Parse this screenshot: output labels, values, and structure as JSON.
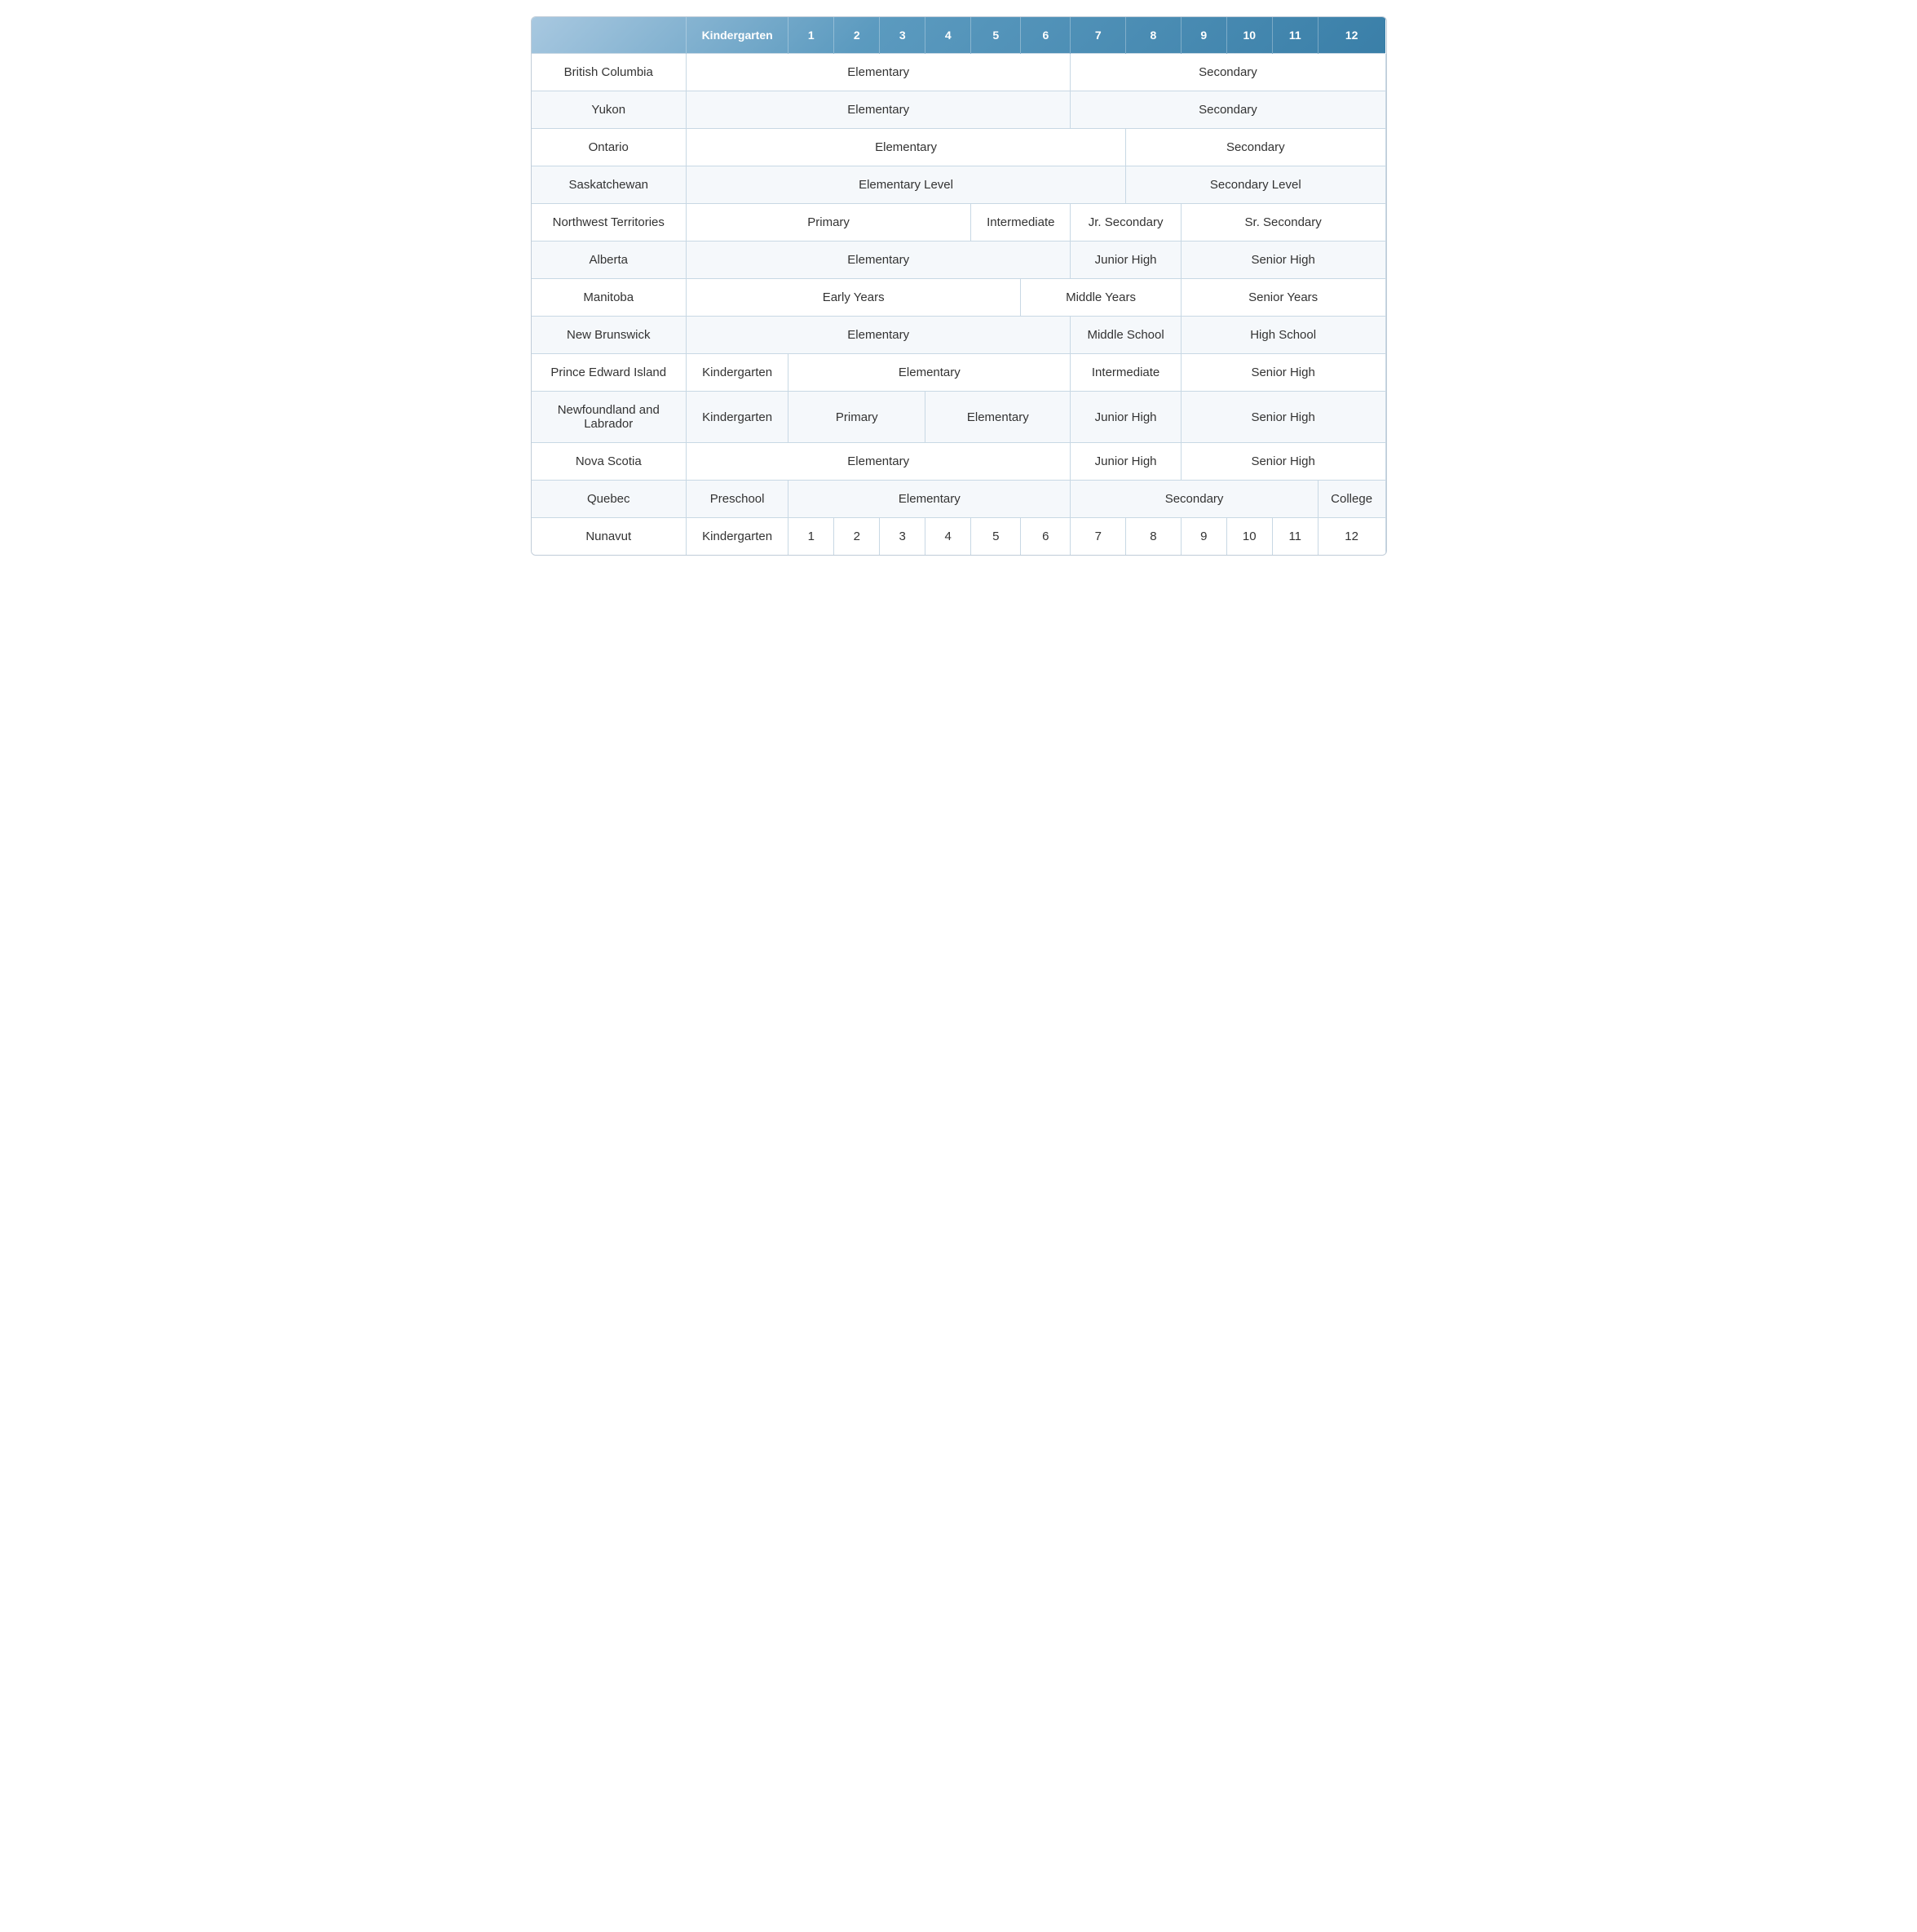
{
  "header": {
    "cols": [
      "Kindergarten",
      "1",
      "2",
      "3",
      "4",
      "5",
      "6",
      "7",
      "8",
      "9",
      "10",
      "11",
      "12"
    ]
  },
  "rows": [
    {
      "province": "British Columbia",
      "segments": [
        {
          "label": "Elementary",
          "start": 1,
          "end": 7
        },
        {
          "label": "Secondary",
          "start": 8,
          "end": 13
        }
      ]
    },
    {
      "province": "Yukon",
      "segments": [
        {
          "label": "Elementary",
          "start": 1,
          "end": 7
        },
        {
          "label": "Secondary",
          "start": 8,
          "end": 13
        }
      ]
    },
    {
      "province": "Ontario",
      "segments": [
        {
          "label": "Elementary",
          "start": 1,
          "end": 8
        },
        {
          "label": "Secondary",
          "start": 9,
          "end": 13
        }
      ]
    },
    {
      "province": "Saskatchewan",
      "segments": [
        {
          "label": "Elementary Level",
          "start": 1,
          "end": 8
        },
        {
          "label": "Secondary Level",
          "start": 9,
          "end": 13
        }
      ]
    },
    {
      "province": "Northwest Territories",
      "segments": [
        {
          "label": "Primary",
          "start": 1,
          "end": 5
        },
        {
          "label": "Intermediate",
          "start": 6,
          "end": 7
        },
        {
          "label": "Jr. Secondary",
          "start": 8,
          "end": 9
        },
        {
          "label": "Sr. Secondary",
          "start": 10,
          "end": 13
        }
      ]
    },
    {
      "province": "Alberta",
      "segments": [
        {
          "label": "Elementary",
          "start": 1,
          "end": 7
        },
        {
          "label": "Junior High",
          "start": 8,
          "end": 9
        },
        {
          "label": "Senior High",
          "start": 10,
          "end": 13
        }
      ]
    },
    {
      "province": "Manitoba",
      "segments": [
        {
          "label": "Early Years",
          "start": 1,
          "end": 6
        },
        {
          "label": "Middle Years",
          "start": 7,
          "end": 9
        },
        {
          "label": "Senior Years",
          "start": 10,
          "end": 13
        }
      ]
    },
    {
      "province": "New Brunswick",
      "segments": [
        {
          "label": "Elementary",
          "start": 1,
          "end": 7
        },
        {
          "label": "Middle School",
          "start": 8,
          "end": 9
        },
        {
          "label": "High School",
          "start": 10,
          "end": 13
        }
      ]
    },
    {
      "province": "Prince Edward Island",
      "segments": [
        {
          "label": "Kindergarten",
          "start": 1,
          "end": 1
        },
        {
          "label": "Elementary",
          "start": 2,
          "end": 7
        },
        {
          "label": "Intermediate",
          "start": 8,
          "end": 9
        },
        {
          "label": "Senior High",
          "start": 10,
          "end": 13
        }
      ]
    },
    {
      "province": "Newfoundland and Labrador",
      "segments": [
        {
          "label": "Kindergarten",
          "start": 1,
          "end": 1
        },
        {
          "label": "Primary",
          "start": 2,
          "end": 4
        },
        {
          "label": "Elementary",
          "start": 5,
          "end": 7
        },
        {
          "label": "Junior High",
          "start": 8,
          "end": 9
        },
        {
          "label": "Senior High",
          "start": 10,
          "end": 13
        }
      ]
    },
    {
      "province": "Nova Scotia",
      "segments": [
        {
          "label": "Elementary",
          "start": 1,
          "end": 7
        },
        {
          "label": "Junior High",
          "start": 8,
          "end": 9
        },
        {
          "label": "Senior High",
          "start": 10,
          "end": 13
        }
      ]
    },
    {
      "province": "Quebec",
      "segments": [
        {
          "label": "Preschool",
          "start": 1,
          "end": 1
        },
        {
          "label": "Elementary",
          "start": 2,
          "end": 7
        },
        {
          "label": "Secondary",
          "start": 8,
          "end": 12
        },
        {
          "label": "College",
          "start": 13,
          "end": 13
        }
      ]
    },
    {
      "province": "Nunavut",
      "segments": [
        {
          "label": "Kindergarten",
          "start": 1,
          "end": 1
        },
        {
          "label": "1",
          "start": 2,
          "end": 2
        },
        {
          "label": "2",
          "start": 3,
          "end": 3
        },
        {
          "label": "3",
          "start": 4,
          "end": 4
        },
        {
          "label": "4",
          "start": 5,
          "end": 5
        },
        {
          "label": "5",
          "start": 6,
          "end": 6
        },
        {
          "label": "6",
          "start": 7,
          "end": 7
        },
        {
          "label": "7",
          "start": 8,
          "end": 8
        },
        {
          "label": "8",
          "start": 9,
          "end": 9
        },
        {
          "label": "9",
          "start": 10,
          "end": 10
        },
        {
          "label": "10",
          "start": 11,
          "end": 11
        },
        {
          "label": "11",
          "start": 12,
          "end": 12
        },
        {
          "label": "12",
          "start": 13,
          "end": 13
        }
      ]
    }
  ]
}
